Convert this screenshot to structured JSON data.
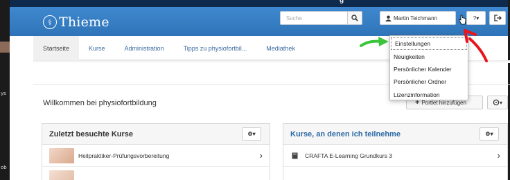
{
  "header": {
    "logo_text": "Thieme",
    "logo_glyph": "⚕",
    "top_text": "g"
  },
  "search": {
    "placeholder": "Suche"
  },
  "user": {
    "name": "Martin Teichmann",
    "caret": "▾"
  },
  "help": {
    "label": "?▾"
  },
  "nav": {
    "items": [
      {
        "label": "Startseite"
      },
      {
        "label": "Kurse"
      },
      {
        "label": "Administration"
      },
      {
        "label": "Tipps zu physiofortbil..."
      },
      {
        "label": "Mediathek"
      }
    ]
  },
  "user_menu": {
    "items": [
      {
        "label": "Einstellungen"
      },
      {
        "label": "Neuigkeiten"
      },
      {
        "label": "Persönlicher Kalender"
      },
      {
        "label": "Persönlicher Ordner"
      },
      {
        "label": "Lizenzinformation"
      }
    ]
  },
  "main": {
    "welcome": "Willkommen bei physiofortbildung",
    "add_portlet": "Portlet hinzufügen",
    "gear_caret": "▾"
  },
  "panels": {
    "recent": {
      "title": "Zuletzt besuchte Kurse",
      "rows": [
        {
          "label": "Heilpraktiker-Prüfungsvorbereitung"
        }
      ]
    },
    "enrolled": {
      "title": "Kurse, an denen ich teilnehme",
      "rows": [
        {
          "label": "CRAFTA E-Learning Grundkurs 3"
        }
      ]
    }
  },
  "left_strip": {
    "labels": [
      "ys",
      "ob"
    ]
  },
  "colors": {
    "header_blue": "#3a82c8",
    "arrow_green": "#3cc43c",
    "arrow_red": "#e8141e"
  }
}
